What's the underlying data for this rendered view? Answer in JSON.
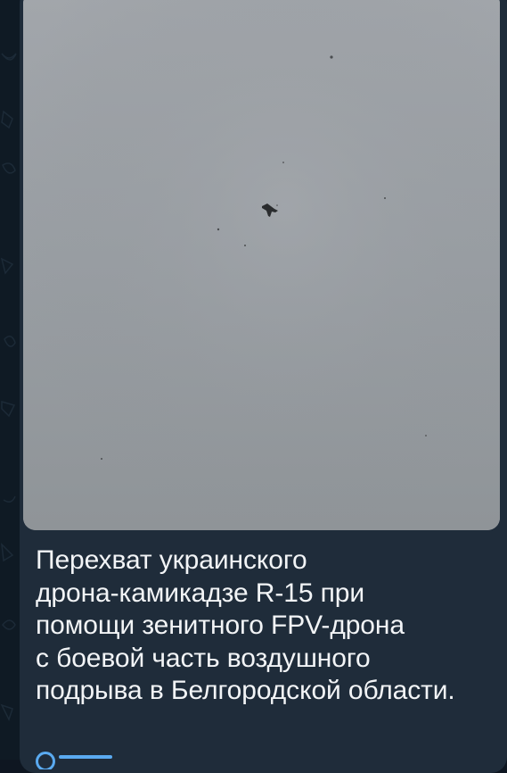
{
  "message": {
    "media": {
      "type": "video-frame",
      "description_icon": "drone-silhouette-icon"
    },
    "caption_lines": [
      "Перехват украинского",
      "дрона-камикадзе R-15 при",
      "помощи зенитного FPV-дрона",
      "с боевой часть воздушного",
      "подрыва в Белгородской области."
    ]
  },
  "colors": {
    "chat_background": "#0f1a24",
    "bubble": "#1f2c3a",
    "caption_text": "#f2f4f6",
    "link_accent": "#5aaaf0"
  }
}
